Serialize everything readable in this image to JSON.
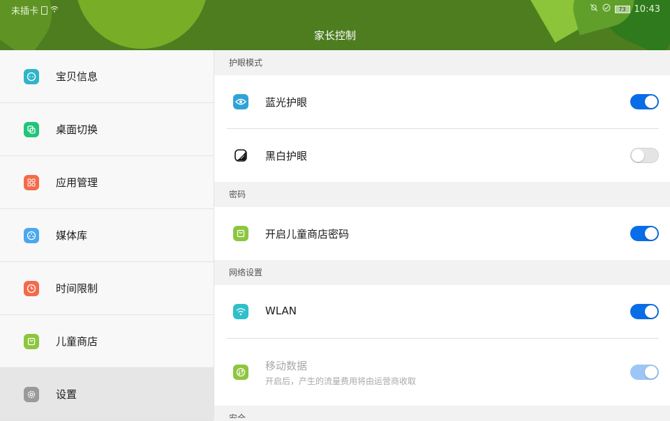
{
  "status_bar": {
    "carrier": "未插卡",
    "battery": "73",
    "time": "10:43"
  },
  "header": {
    "title": "家长控制"
  },
  "sidebar": {
    "items": [
      {
        "label": "宝贝信息",
        "icon": "baby-face-icon",
        "color": "#2fb5c9"
      },
      {
        "label": "桌面切换",
        "icon": "switch-icon",
        "color": "#22c47a"
      },
      {
        "label": "应用管理",
        "icon": "grid-icon",
        "color": "#f56a4a"
      },
      {
        "label": "媒体库",
        "icon": "media-icon",
        "color": "#4aa8ef"
      },
      {
        "label": "时间限制",
        "icon": "clock-icon",
        "color": "#f56a4a"
      },
      {
        "label": "儿童商店",
        "icon": "bag-icon",
        "color": "#8cc63f"
      },
      {
        "label": "设置",
        "icon": "gear-icon",
        "color": "#9a9a9a",
        "active": true
      }
    ]
  },
  "main": {
    "sections": [
      {
        "title": "护眼模式",
        "rows": [
          {
            "label": "蓝光护眼",
            "icon": "eye-icon",
            "color": "#2fa3d9",
            "on": true
          },
          {
            "label": "黑白护眼",
            "icon": "grayscale-icon",
            "color": "#ffffff",
            "on": false
          }
        ]
      },
      {
        "title": "密码",
        "rows": [
          {
            "label": "开启儿童商店密码",
            "icon": "bag-icon",
            "color": "#8cc63f",
            "on": true
          }
        ]
      },
      {
        "title": "网络设置",
        "rows": [
          {
            "label": "WLAN",
            "icon": "wifi-icon",
            "color": "#2fc0c9",
            "on": true
          },
          {
            "label": "移动数据",
            "sub": "开启后，产生的流量费用将由运营商收取",
            "icon": "mobile-data-icon",
            "color": "#8cc63f",
            "on": true,
            "disabled": true
          }
        ]
      },
      {
        "title": "安全",
        "rows": []
      }
    ]
  },
  "colors": {
    "header_bg": "#4e7d20",
    "toggle_on": "#0a6de8",
    "toggle_disabled": "#9cc6f5"
  }
}
